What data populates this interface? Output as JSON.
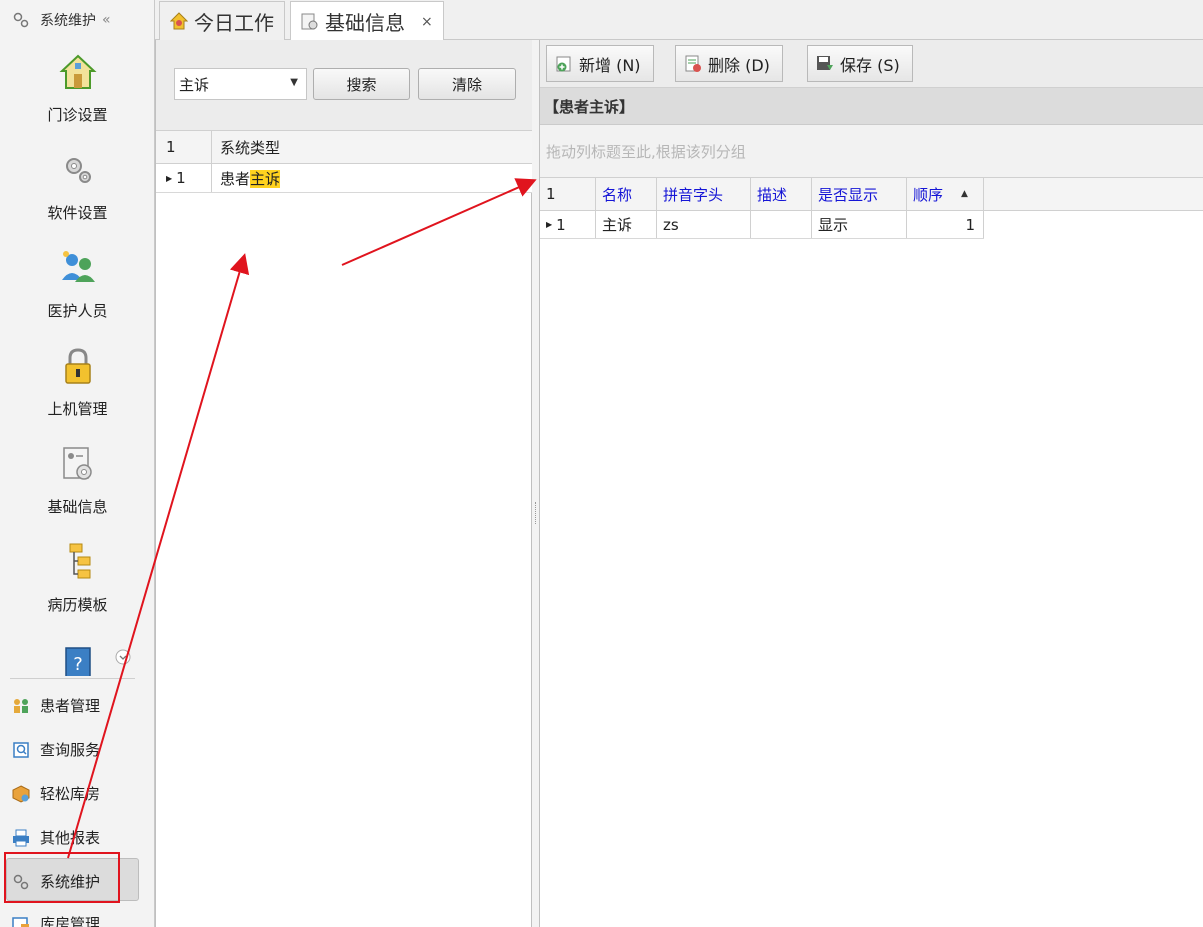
{
  "nav": {
    "header_label": "系统维护",
    "collapse_glyph": "«",
    "big_items": [
      {
        "label": "门诊设置",
        "icon": "home-icon"
      },
      {
        "label": "软件设置",
        "icon": "gears-icon"
      },
      {
        "label": "医护人员",
        "icon": "staff-icon"
      },
      {
        "label": "上机管理",
        "icon": "lock-icon"
      },
      {
        "label": "基础信息",
        "icon": "settings-doc-icon"
      },
      {
        "label": "病历模板",
        "icon": "tree-icon"
      }
    ],
    "small_items": [
      {
        "label": "患者管理",
        "icon": "patients-icon"
      },
      {
        "label": "查询服务",
        "icon": "query-icon"
      },
      {
        "label": "轻松库房",
        "icon": "box-icon"
      },
      {
        "label": "其他报表",
        "icon": "printer-icon"
      },
      {
        "label": "系统维护",
        "icon": "gear-icon"
      },
      {
        "label": "库房管理",
        "icon": "storage-icon"
      }
    ]
  },
  "tabs": [
    {
      "label": "今日工作",
      "icon": "work-icon"
    },
    {
      "label": "基础信息",
      "icon": "settings-icon",
      "close": "×"
    }
  ],
  "left": {
    "combo_value": "主诉",
    "search_label": "搜索",
    "clear_label": "清除",
    "header_num": "1",
    "header_col": "系统类型",
    "row_num": "1",
    "row_text_pre": "患者",
    "row_text_hl": "主诉"
  },
  "right": {
    "toolbar": {
      "add_label": "新增 (N)",
      "delete_label": "删除 (D)",
      "save_label": "保存 (S)"
    },
    "section_title": "【患者主诉】",
    "group_hint": "拖动列标题至此,根据该列分组",
    "columns": [
      "1",
      "名称",
      "拼音字头",
      "描述",
      "是否显示",
      "顺序"
    ],
    "row": {
      "num": "1",
      "name": "主诉",
      "pinyin": "zs",
      "desc": "",
      "show": "显示",
      "order": "1"
    }
  },
  "colors": {
    "accent_blue": "#1515d6",
    "highlight": "#ffd21f",
    "annotation_red": "#e0141e"
  }
}
